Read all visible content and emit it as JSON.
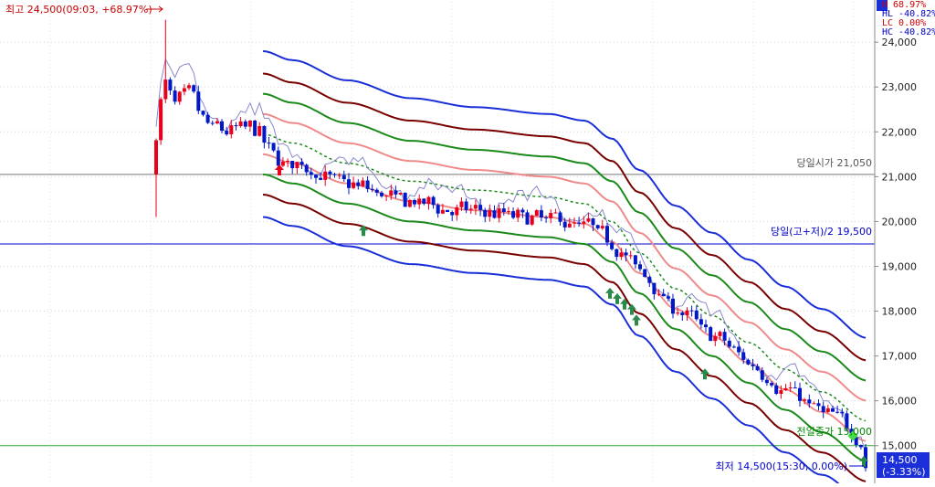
{
  "chart_data": {
    "type": "candlestick",
    "y_axis": {
      "min": 14200,
      "max": 24900,
      "tick_labels": [
        "24,000",
        "23,000",
        "22,000",
        "21,000",
        "20,000",
        "19,000",
        "18,000",
        "17,000",
        "16,000",
        "15,000"
      ],
      "tick_values": [
        24000,
        23000,
        22000,
        21000,
        20000,
        19000,
        18000,
        17000,
        16000,
        15000
      ],
      "position": "right",
      "grid": true
    },
    "x_axis": {
      "bars": 152,
      "x_labels_visible": false
    },
    "header_stats": [
      {
        "label": "H",
        "value": "68.97%",
        "color": "#cc0000"
      },
      {
        "label": "HL",
        "value": "-40.82%",
        "color": "#0000cc"
      },
      {
        "label": "LC",
        "value": "0.00%",
        "color": "#cc0000"
      },
      {
        "label": "HC",
        "value": "-40.82%",
        "color": "#0000cc"
      }
    ],
    "annotations": {
      "high": {
        "text": "최고 24,500(09:03, +68.97%)",
        "value": 24500
      },
      "low": {
        "text": "최저 14,500(15:30, 0.00%)",
        "value": 14500
      },
      "open_line": {
        "text": "당일시가 21,050",
        "value": 21050,
        "color": "#555555"
      },
      "mid_line": {
        "text": "당일(고+저)/2 19,500",
        "value": 19500,
        "color": "#0000cc"
      },
      "prev_close_line": {
        "text": "전일종가 15,000",
        "value": 15000,
        "color": "#008800"
      },
      "current_price": {
        "price": "14,500",
        "change": "(-3.33%)",
        "value": 14500
      }
    },
    "colors": {
      "up": "#e8001c",
      "down": "#0018c8",
      "outer_band": "#1a2fd8",
      "band2": "#7a0000",
      "band3": "#1a8a1a",
      "band4": "#f08a8a",
      "center": "#1a8a1a",
      "thin_line": "#8888cc"
    }
  }
}
